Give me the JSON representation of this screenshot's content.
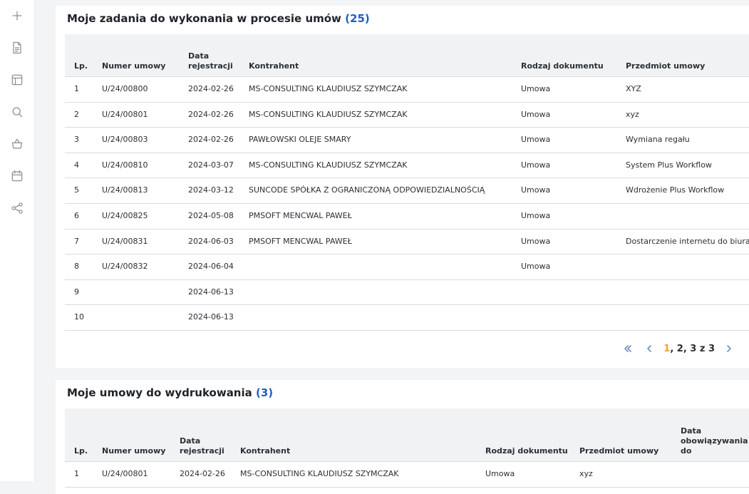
{
  "sidebar": {
    "icons": [
      "plus-icon",
      "document-icon",
      "layout-icon",
      "search-icon",
      "basket-icon",
      "calendar-icon",
      "share-icon"
    ]
  },
  "tasks_panel": {
    "title": "Moje zadania do wykonania w procesie umów",
    "count": "(25)",
    "columns": {
      "lp": "Lp.",
      "numer": "Numer umowy",
      "data1": "Data",
      "data2": "rejestracji",
      "kontrahent": "Kontrahent",
      "rodzaj": "Rodzaj dokumentu",
      "przedmiot": "Przedmiot umowy"
    },
    "rows": [
      {
        "lp": "1",
        "numer": "U/24/00800",
        "data": "2024-02-26",
        "kontrahent": "MS-CONSULTING KLAUDIUSZ SZYMCZAK",
        "rodzaj": "Umowa",
        "przedmiot": "XYZ"
      },
      {
        "lp": "2",
        "numer": "U/24/00801",
        "data": "2024-02-26",
        "kontrahent": "MS-CONSULTING KLAUDIUSZ SZYMCZAK",
        "rodzaj": "Umowa",
        "przedmiot": "xyz"
      },
      {
        "lp": "3",
        "numer": "U/24/00803",
        "data": "2024-02-26",
        "kontrahent": "PAWŁOWSKI OLEJE SMARY",
        "rodzaj": "Umowa",
        "przedmiot": "Wymiana regału"
      },
      {
        "lp": "4",
        "numer": "U/24/00810",
        "data": "2024-03-07",
        "kontrahent": "MS-CONSULTING KLAUDIUSZ SZYMCZAK",
        "rodzaj": "Umowa",
        "przedmiot": "System Plus Workflow"
      },
      {
        "lp": "5",
        "numer": "U/24/00813",
        "data": "2024-03-12",
        "kontrahent": "SUNCODE SPÓŁKA Z OGRANICZONĄ ODPOWIEDZIALNOŚCIĄ",
        "rodzaj": "Umowa",
        "przedmiot": "Wdrożenie Plus Workflow"
      },
      {
        "lp": "6",
        "numer": "U/24/00825",
        "data": "2024-05-08",
        "kontrahent": "PMSOFT MENCWAL PAWEŁ",
        "rodzaj": "Umowa",
        "przedmiot": ""
      },
      {
        "lp": "7",
        "numer": "U/24/00831",
        "data": "2024-06-03",
        "kontrahent": "PMSOFT MENCWAL PAWEŁ",
        "rodzaj": "Umowa",
        "przedmiot": "Dostarczenie internetu do biura"
      },
      {
        "lp": "8",
        "numer": "U/24/00832",
        "data": "2024-06-04",
        "kontrahent": "",
        "rodzaj": "Umowa",
        "przedmiot": ""
      },
      {
        "lp": "9",
        "numer": "",
        "data": "2024-06-13",
        "kontrahent": "",
        "rodzaj": "",
        "przedmiot": ""
      },
      {
        "lp": "10",
        "numer": "",
        "data": "2024-06-13",
        "kontrahent": "",
        "rodzaj": "",
        "przedmiot": ""
      }
    ],
    "pagination": {
      "current": "1",
      "rest": ", 2, 3 z 3"
    }
  },
  "print_panel": {
    "title": "Moje umowy do wydrukowania",
    "count": "(3)",
    "columns": {
      "lp": "Lp.",
      "numer": "Numer umowy",
      "data1": "Data",
      "data2": "rejestracji",
      "kontrahent": "Kontrahent",
      "rodzaj": "Rodzaj dokumentu",
      "przedmiot": "Przedmiot umowy",
      "obow1": "Data",
      "obow2": "obowiązywania",
      "obow3": "do"
    },
    "rows": [
      {
        "lp": "1",
        "numer": "U/24/00801",
        "data": "2024-02-26",
        "kontrahent": "MS-CONSULTING KLAUDIUSZ SZYMCZAK",
        "rodzaj": "Umowa",
        "przedmiot": "xyz",
        "obow": ""
      }
    ]
  }
}
